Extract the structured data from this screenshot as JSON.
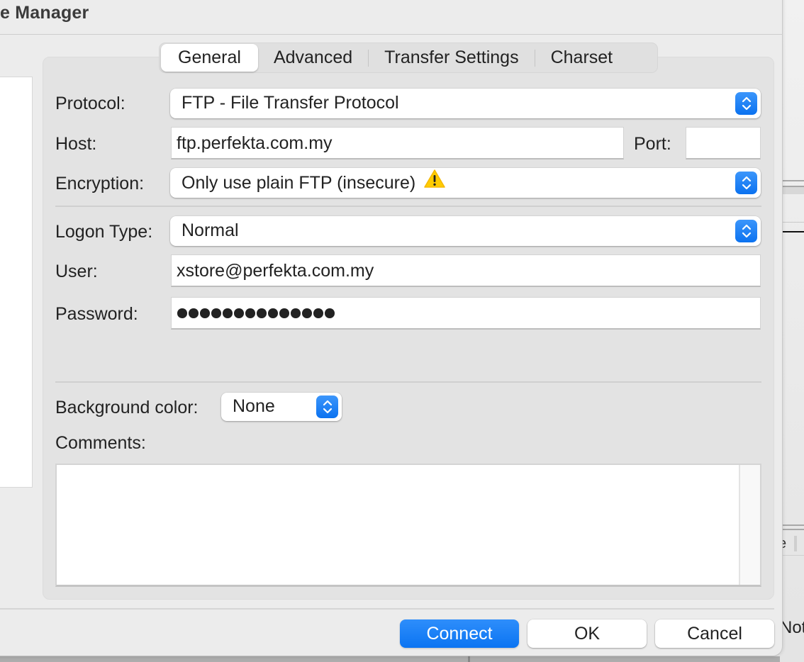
{
  "window": {
    "title_fragment": "e Manager"
  },
  "tabs": [
    {
      "label": "General",
      "active": true
    },
    {
      "label": "Advanced",
      "active": false
    },
    {
      "label": "Transfer Settings",
      "active": false
    },
    {
      "label": "Charset",
      "active": false
    }
  ],
  "form": {
    "protocol": {
      "label": "Protocol:",
      "value": "FTP - File Transfer Protocol"
    },
    "host": {
      "label": "Host:",
      "value": "ftp.perfekta.com.my"
    },
    "port": {
      "label": "Port:",
      "value": ""
    },
    "encryption": {
      "label": "Encryption:",
      "value": "Only use plain FTP (insecure)",
      "icon": "warning-icon"
    },
    "logon_type": {
      "label": "Logon Type:",
      "value": "Normal"
    },
    "user": {
      "label": "User:",
      "value": "xstore@perfekta.com.my"
    },
    "password": {
      "label": "Password:",
      "masked_length": 14
    },
    "background_color": {
      "label": "Background color:",
      "value": "None"
    },
    "comments": {
      "label": "Comments:",
      "value": ""
    }
  },
  "buttons": {
    "connect": "Connect",
    "ok": "OK",
    "cancel": "Cancel"
  },
  "background_window": {
    "fragment_e": "e",
    "fragment_not": "Not"
  },
  "colors": {
    "accent": "#0b74f2",
    "warning": "#ffcc00"
  }
}
